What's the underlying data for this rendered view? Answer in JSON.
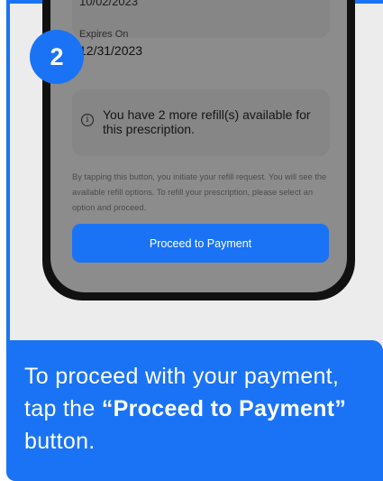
{
  "step": {
    "number": "2"
  },
  "prescription": {
    "date_partial": "10/02/2023",
    "expires_label": "Expires On",
    "expires_value": "12/31/2023"
  },
  "refill": {
    "info_icon": "info-icon",
    "message": "You have 2 more refill(s) available for this prescription."
  },
  "disclaimer": "By tapping this button, you initiate your refill request. You will see the available refill options. To refill your prescription, please select an option and proceed.",
  "pay_button_label": "Proceed to Payment",
  "instruction": {
    "prefix": "To proceed with your payment, tap the ",
    "highlight": "“Proceed to Payment”",
    "suffix": " button."
  },
  "colors": {
    "accent": "#1a73f5",
    "dim_overlay": "#8c8c8c",
    "card_bg": "#ececec"
  }
}
